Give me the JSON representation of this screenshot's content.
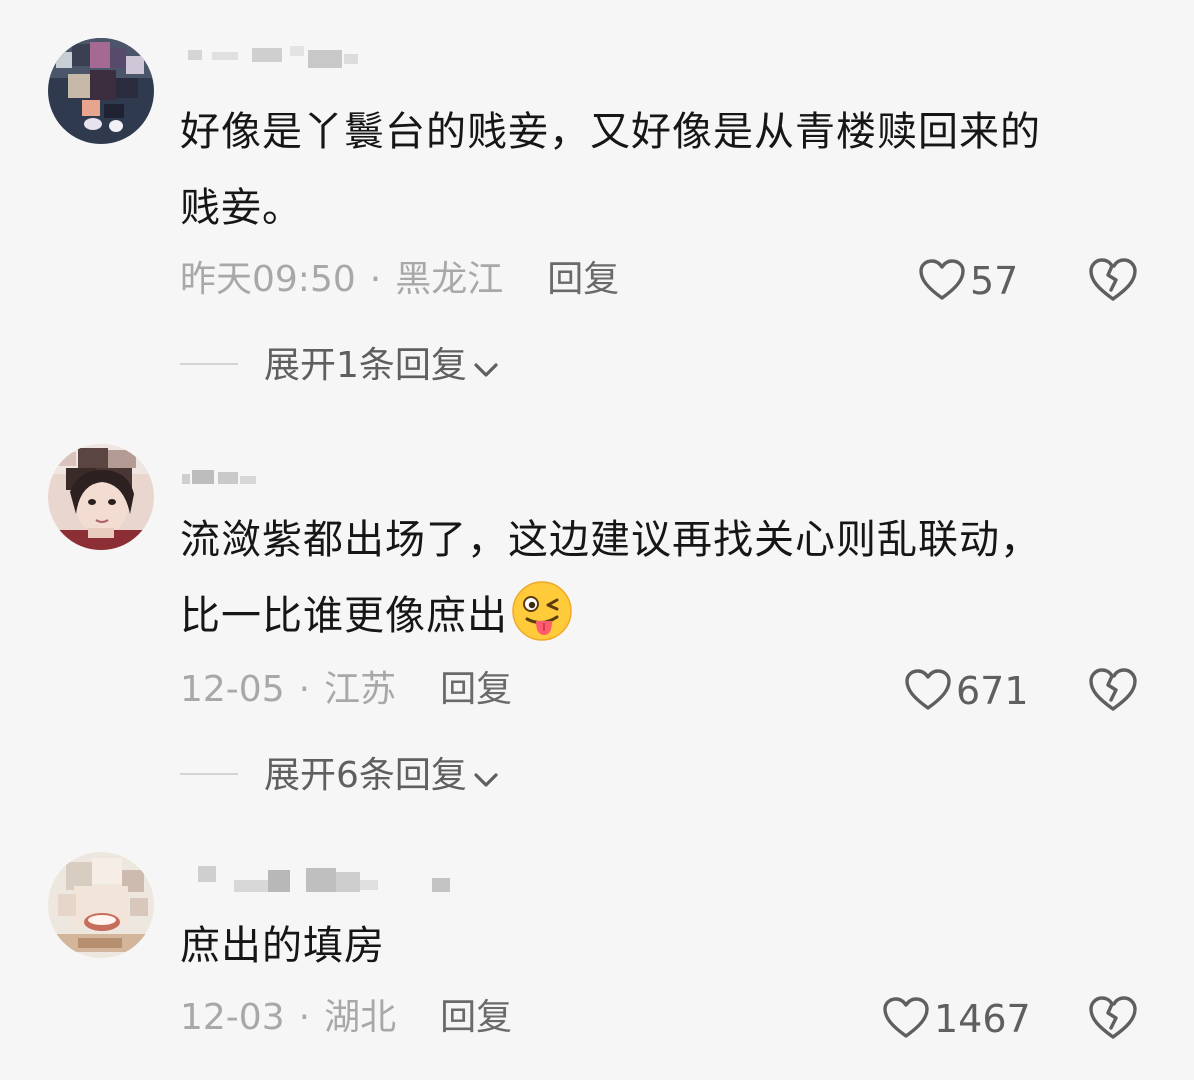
{
  "comments": [
    {
      "avatar_icon": "user-avatar-blurred",
      "username_blurred": true,
      "text_line1": "好像是丫鬟台的贱妾，又好像是从青楼赎回来的",
      "text_line2": "贱妾。",
      "time": "昨天09:50",
      "location": "黑龙江",
      "reply_label": "回复",
      "likes": "57",
      "expand_label": "展开1条回复"
    },
    {
      "avatar_icon": "user-avatar-cartoon-blurred",
      "username_blurred": true,
      "text_line1": "流潋紫都出场了，这边建议再找关心则乱联动，",
      "text_line2": "比一比谁更像庶出",
      "emoji": "wink-tongue-emoji",
      "time": "12-05",
      "location": "江苏",
      "reply_label": "回复",
      "likes": "671",
      "expand_label": "展开6条回复"
    },
    {
      "avatar_icon": "user-avatar-blurred",
      "username_blurred": true,
      "text_line1": "庶出的填房",
      "time": "12-03",
      "location": "湖北",
      "reply_label": "回复",
      "likes": "1467"
    }
  ],
  "separator": "·",
  "colors": {
    "background": "#f6f6f6",
    "text": "#161616",
    "meta": "#a8a8a8",
    "secondary": "#5f5f5f"
  }
}
